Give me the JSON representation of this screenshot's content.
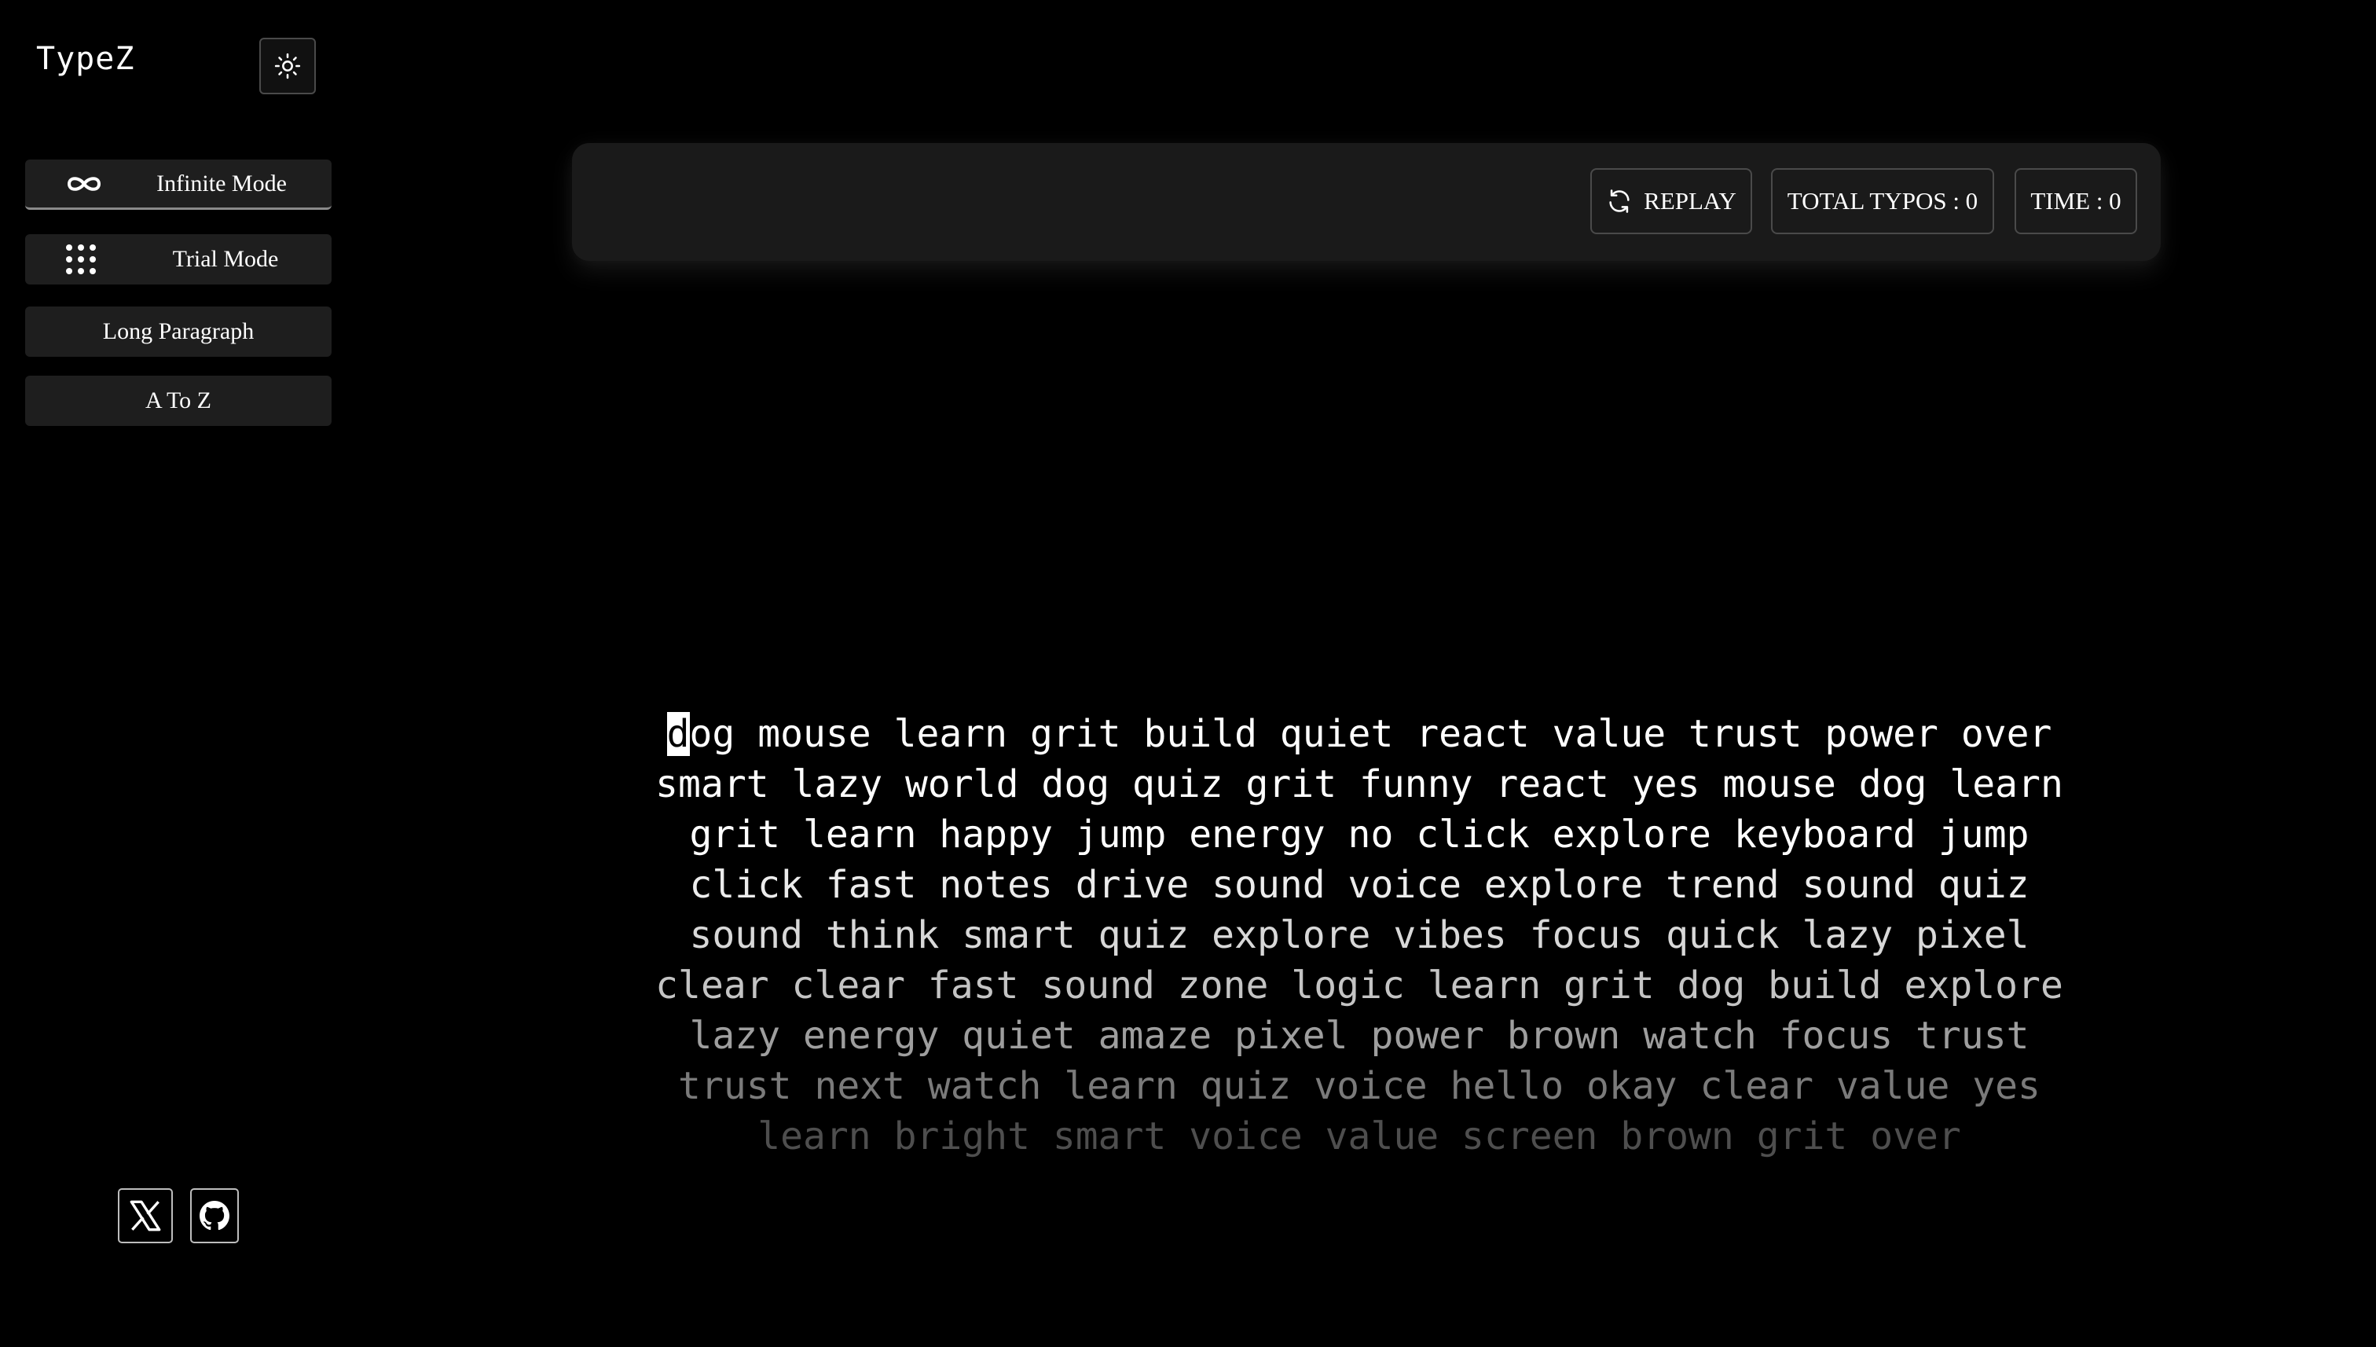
{
  "app": {
    "title": "TypeZ"
  },
  "sidebar": {
    "theme_toggle_icon": "sun-icon",
    "modes": [
      {
        "label": "Infinite Mode",
        "icon": "infinity-icon",
        "active": true
      },
      {
        "label": "Trial Mode",
        "icon": "grid-dots-icon",
        "active": false
      },
      {
        "label": "Long Paragraph",
        "active": false
      },
      {
        "label": "A To Z",
        "active": false
      }
    ],
    "social": [
      {
        "icon": "x-logo-icon"
      },
      {
        "icon": "github-icon"
      }
    ]
  },
  "stats": {
    "replay_label": "REPLAY",
    "typos_label": "TOTAL TYPOS : 0",
    "time_label": "TIME : 0"
  },
  "typing": {
    "cursor_char": "d",
    "lines": [
      "og mouse learn grit build quiet react value trust power over",
      "smart lazy world dog quiz grit funny react yes mouse dog learn",
      "grit learn happy jump energy no click explore keyboard jump",
      "click fast notes drive sound voice explore trend sound quiz",
      "sound think smart quiz explore vibes focus quick lazy pixel",
      "clear clear fast sound zone logic learn grit dog build explore",
      "lazy energy quiet amaze pixel power brown watch focus trust",
      "trust next watch learn quiz voice hello okay clear value yes",
      "learn bright smart voice value screen brown grit over"
    ],
    "line_colors": [
      "#ffffff",
      "#ffffff",
      "#ffffff",
      "#ececec",
      "#d8d8d8",
      "#c4c4c4",
      "#9e9e9e",
      "#7a7a7a",
      "#4e4e4e"
    ]
  },
  "colors": {
    "background": "#000000",
    "panel": "#1a1a1a",
    "button": "#1e1e1e",
    "border": "#4a4a4a",
    "text": "#ffffff"
  }
}
